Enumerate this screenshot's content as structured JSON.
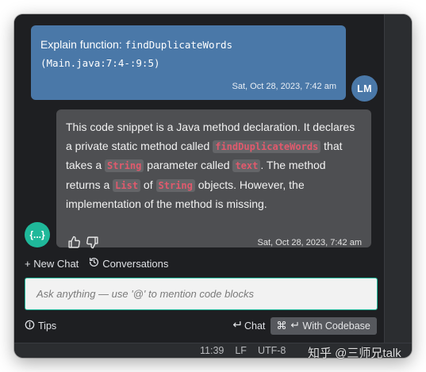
{
  "user_message": {
    "prefix": "Explain function: ",
    "function_name": "findDuplicateWords",
    "location": "(Main.java:7:4-:9:5)",
    "timestamp": "Sat, Oct 28, 2023, 7:42 am",
    "avatar_initials": "LM"
  },
  "bot_message": {
    "t1": "This code snippet is a Java method declaration. It declares a private static method called ",
    "c1": "findDuplicateWords",
    "t2": " that takes a ",
    "c2": "String",
    "t3": " parameter called ",
    "c3": "text",
    "t4": ". The method returns a ",
    "c4": "List",
    "t5": " of ",
    "c5": "String",
    "t6": " objects. However, the implementation of the method is missing.",
    "timestamp": "Sat, Oct 28, 2023, 7:42 am",
    "avatar_glyph": "{...}"
  },
  "toolbar": {
    "new_chat": "+ New Chat",
    "conversations": "Conversations"
  },
  "input": {
    "placeholder": "Ask anything — use '@' to mention code blocks"
  },
  "footer": {
    "tips": "Tips",
    "chat": "Chat",
    "with_codebase": "With Codebase"
  },
  "status_bar": {
    "position": "11:39",
    "line_ending": "LF",
    "encoding": "UTF-8"
  },
  "watermark": "知乎 @三师兄talk",
  "colors": {
    "user_bubble": "#4a78a8",
    "bot_bubble": "#4e4f52",
    "accent": "#1fb89a",
    "code_chip_text": "#e05a6d"
  },
  "icons": {
    "conversations": "history-icon",
    "tips": "info-icon",
    "chat": "enter-icon",
    "codebase": "command-icon",
    "like": "thumbs-up-icon",
    "dislike": "thumbs-down-icon"
  }
}
